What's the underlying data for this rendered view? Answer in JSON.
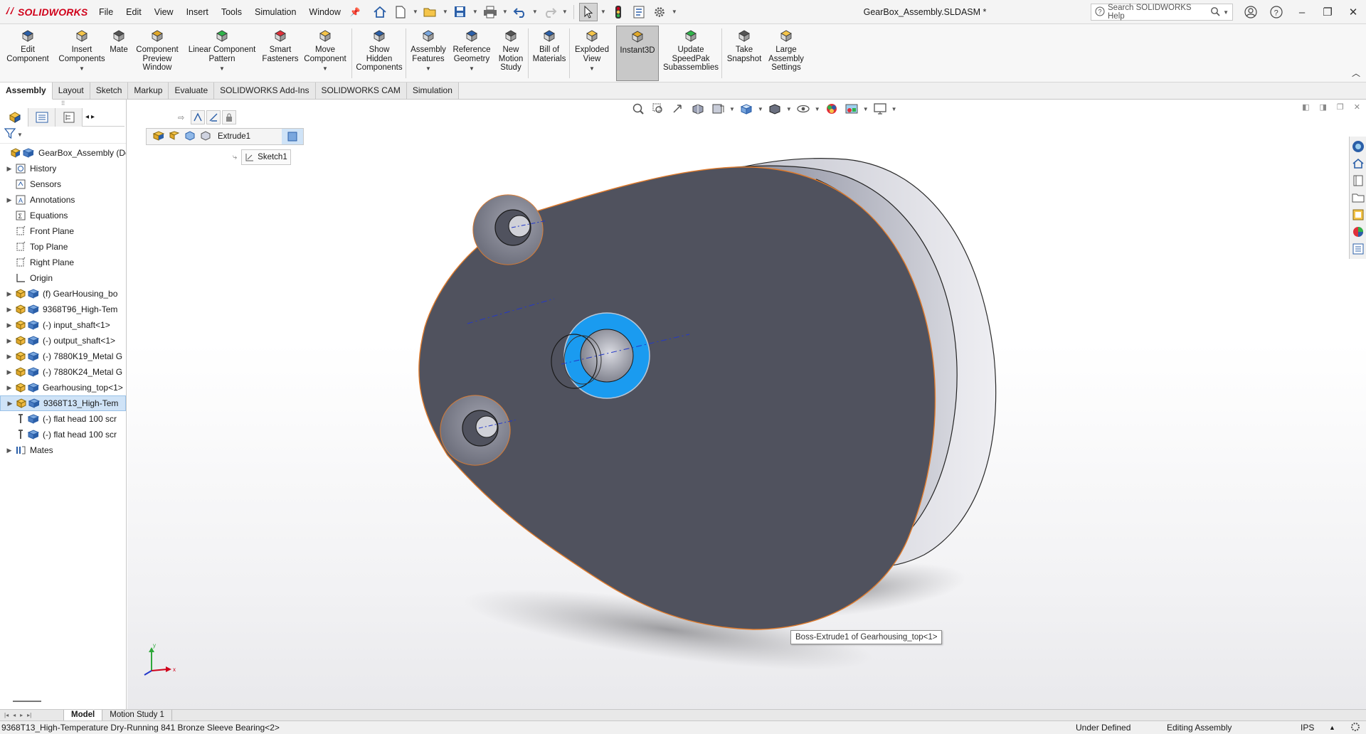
{
  "app": {
    "name": "SOLIDWORKS",
    "logo_prefix": "3S",
    "document_title": "GearBox_Assembly.SLDASM *"
  },
  "menu": [
    "File",
    "Edit",
    "View",
    "Insert",
    "Tools",
    "Simulation",
    "Window"
  ],
  "search": {
    "placeholder": "Search SOLIDWORKS Help"
  },
  "commands": [
    {
      "label": "Edit\nComponent",
      "icon": "edit-component-icon"
    },
    {
      "label": "Insert\nComponents",
      "icon": "insert-components-icon",
      "has_menu": true
    },
    {
      "label": "Mate",
      "icon": "mate-icon"
    },
    {
      "label": "Component\nPreview\nWindow",
      "icon": "component-preview-icon"
    },
    {
      "label": "Linear Component\nPattern",
      "icon": "linear-pattern-icon",
      "has_menu": true
    },
    {
      "label": "Smart\nFasteners",
      "icon": "smart-fasteners-icon"
    },
    {
      "label": "Move\nComponent",
      "icon": "move-component-icon",
      "has_menu": true
    },
    {
      "label": "Show\nHidden\nComponents",
      "icon": "show-hidden-icon"
    },
    {
      "label": "Assembly\nFeatures",
      "icon": "assembly-features-icon",
      "has_menu": true
    },
    {
      "label": "Reference\nGeometry",
      "icon": "reference-geometry-icon",
      "has_menu": true
    },
    {
      "label": "New\nMotion\nStudy",
      "icon": "motion-study-icon"
    },
    {
      "label": "Bill of\nMaterials",
      "icon": "bill-of-materials-icon"
    },
    {
      "label": "Exploded\nView",
      "icon": "exploded-view-icon",
      "has_menu": true
    },
    {
      "label": "Instant3D",
      "icon": "instant3d-icon",
      "active": true
    },
    {
      "label": "Update\nSpeedPak\nSubassemblies",
      "icon": "speedpak-icon"
    },
    {
      "label": "Take\nSnapshot",
      "icon": "snapshot-icon"
    },
    {
      "label": "Large\nAssembly\nSettings",
      "icon": "large-assembly-icon"
    }
  ],
  "tabs": [
    {
      "label": "Assembly",
      "active": true
    },
    {
      "label": "Layout"
    },
    {
      "label": "Sketch"
    },
    {
      "label": "Markup"
    },
    {
      "label": "Evaluate"
    },
    {
      "label": "SOLIDWORKS Add-Ins"
    },
    {
      "label": "SOLIDWORKS CAM"
    },
    {
      "label": "Simulation"
    }
  ],
  "tree": [
    {
      "label": "GearBox_Assembly (Def",
      "icon": "assembly-icon",
      "expand": "",
      "level": 0
    },
    {
      "label": "History",
      "icon": "history-folder-icon",
      "expand": "▶",
      "level": 1
    },
    {
      "label": "Sensors",
      "icon": "sensors-icon",
      "expand": "",
      "level": 1
    },
    {
      "label": "Annotations",
      "icon": "annotations-icon",
      "expand": "▶",
      "level": 1
    },
    {
      "label": "Equations",
      "icon": "equations-icon",
      "expand": "",
      "level": 1
    },
    {
      "label": "Front Plane",
      "icon": "plane-icon",
      "expand": "",
      "level": 1
    },
    {
      "label": "Top Plane",
      "icon": "plane-icon",
      "expand": "",
      "level": 1
    },
    {
      "label": "Right Plane",
      "icon": "plane-icon",
      "expand": "",
      "level": 1
    },
    {
      "label": "Origin",
      "icon": "origin-icon",
      "expand": "",
      "level": 1
    },
    {
      "label": "(f) GearHousing_bo",
      "icon": "part-icon",
      "expand": "▶",
      "level": 1
    },
    {
      "label": "9368T96_High-Tem",
      "icon": "part-icon",
      "expand": "▶",
      "level": 1
    },
    {
      "label": "(-) input_shaft<1>",
      "icon": "part-icon",
      "expand": "▶",
      "level": 1
    },
    {
      "label": "(-) output_shaft<1>",
      "icon": "part-icon",
      "expand": "▶",
      "level": 1
    },
    {
      "label": "(-) 7880K19_Metal G",
      "icon": "part-icon",
      "expand": "▶",
      "level": 1
    },
    {
      "label": "(-) 7880K24_Metal G",
      "icon": "part-icon",
      "expand": "▶",
      "level": 1
    },
    {
      "label": "Gearhousing_top<1>",
      "icon": "part-icon",
      "expand": "▶",
      "level": 1
    },
    {
      "label": "9368T13_High-Tem",
      "icon": "part-icon",
      "expand": "▶",
      "level": 1,
      "selected": true
    },
    {
      "label": "(-) flat head 100 scr",
      "icon": "screw-icon",
      "expand": "",
      "level": 1
    },
    {
      "label": "(-) flat head 100 scr",
      "icon": "screw-icon",
      "expand": "",
      "level": 1
    },
    {
      "label": "Mates",
      "icon": "mates-icon",
      "expand": "▶",
      "level": 1
    }
  ],
  "breadcrumb": {
    "feature": "Extrude1",
    "sketch": "Sketch1"
  },
  "tooltip": "Boss-Extrude1 of Gearhousing_top<1>",
  "triad": {
    "y": "y",
    "x": "x"
  },
  "bottom_tabs": [
    {
      "label": "Model",
      "active": true
    },
    {
      "label": "Motion Study 1"
    }
  ],
  "status": {
    "selected": "9368T13_High-Temperature Dry-Running 841 Bronze Sleeve Bearing<2>",
    "definition": "Under Defined",
    "mode": "Editing Assembly",
    "units": "IPS"
  },
  "colors": {
    "brand": "#d0021b",
    "part_face": "#50525e",
    "highlight_blue": "#1a9bf0",
    "edge_orange": "#e07b2c",
    "selection": "#cfe3f7"
  }
}
